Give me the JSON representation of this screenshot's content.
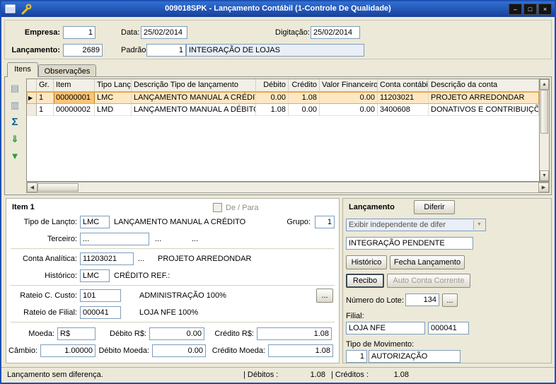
{
  "window": {
    "title": "009018SPK - Lançamento Contábil (1-Controle De Qualidade)"
  },
  "icons": {
    "minimize": "–",
    "maximize": "□",
    "close": "×",
    "new_item": "▤",
    "copy_item": "▥",
    "sum": "Σ",
    "export": "⇓",
    "filter": "▼",
    "row_arrow": "▶",
    "dropdown_arrow": "▼",
    "scroll_up": "▲",
    "scroll_down": "▼",
    "scroll_left": "◀",
    "scroll_right": "▶"
  },
  "header": {
    "empresa_label": "Empresa:",
    "empresa_value": "1",
    "data_label": "Data:",
    "data_value": "25/02/2014",
    "digitacao_label": "Digitação:",
    "digitacao_value": "25/02/2014",
    "lancamento_label": "Lançamento:",
    "lancamento_value": "2689",
    "padrao_label": "Padrão:",
    "padrao_code": "1",
    "padrao_desc": "INTEGRAÇÃO DE LOJAS"
  },
  "tabs": {
    "itens": "Itens",
    "observacoes": "Observações"
  },
  "grid": {
    "columns": [
      "Gr.",
      "Item",
      "Tipo Lanç.",
      "Descrição Tipo de lançamento",
      "Débito",
      "Crédito",
      "Valor Financeiro",
      "Conta contábil",
      "Descrição da conta"
    ],
    "rows": [
      {
        "gr": "1",
        "item": "00000001",
        "tipo": "LMC",
        "desc": "LANÇAMENTO MANUAL A CRÉDITO",
        "debito": "0.00",
        "credito": "1.08",
        "valor_fin": "0.00",
        "conta": "11203021",
        "conta_desc": "PROJETO ARREDONDAR"
      },
      {
        "gr": "1",
        "item": "00000002",
        "tipo": "LMD",
        "desc": "LANÇAMENTO MANUAL A DÉBITO",
        "debito": "1.08",
        "credito": "0.00",
        "valor_fin": "0.00",
        "conta": "3400608",
        "conta_desc": "DONATIVOS E CONTRIBUIÇÕES"
      }
    ]
  },
  "item_panel": {
    "title": "Item 1",
    "de_para_label": "De / Para",
    "tipo_lancto_label": "Tipo de Lançto:",
    "tipo_lancto_value": "LMC",
    "tipo_lancto_desc": "LANÇAMENTO MANUAL A CRÉDITO",
    "grupo_label": "Grupo:",
    "grupo_value": "1",
    "terceiro_label": "Terceiro:",
    "terceiro_value": "...",
    "terceiro_dots": "...",
    "terceiro_desc": "...",
    "conta_analitica_label": "Conta Analítica:",
    "conta_analitica_value": "11203021",
    "conta_analitica_dots": "...",
    "conta_analitica_desc": "PROJETO ARREDONDAR",
    "historico_label": "Histórico:",
    "historico_value": "LMC",
    "historico_desc": "CRÉDITO REF.:",
    "rateio_cc_label": "Rateio C. Custo:",
    "rateio_cc_value": "101",
    "rateio_cc_desc": "ADMINISTRAÇÃO 100%",
    "rateio_cc_button": "...",
    "rateio_filial_label": "Rateio de Filial:",
    "rateio_filial_value": "000041",
    "rateio_filial_desc": "LOJA NFE 100%",
    "moeda_label": "Moeda:",
    "moeda_value": "R$",
    "debito_rs_label": "Débito R$:",
    "debito_rs_value": "0.00",
    "credito_rs_label": "Crédito R$:",
    "credito_rs_value": "1.08",
    "cambio_label": "Câmbio:",
    "cambio_value": "1.00000",
    "debito_moeda_label": "Débito Moeda:",
    "debito_moeda_value": "0.00",
    "credito_moeda_label": "Crédito Moeda:",
    "credito_moeda_value": "1.08"
  },
  "lancamento_panel": {
    "title": "Lançamento",
    "diferir_button": "Diferir",
    "exibir_dropdown": "Exibir independente de difer",
    "status_field": "INTEGRAÇÃO PENDENTE",
    "historico_button": "Histórico",
    "fecha_button": "Fecha Lançamento",
    "recibo_button": "Recibo",
    "auto_cc_button": "Auto Conta Corrente",
    "lote_label": "Número do Lote:",
    "lote_value": "134",
    "lote_button": "...",
    "filial_label": "Filial:",
    "filial_name": "LOJA NFE",
    "filial_code": "000041",
    "tipo_mov_label": "Tipo de Movimento:",
    "tipo_mov_code": "1",
    "tipo_mov_desc": "AUTORIZAÇÃO"
  },
  "status_bar": {
    "message": "Lançamento sem diferença.",
    "debitos_label": "| Débitos :",
    "debitos_value": "1.08",
    "creditos_label": "| Créditos :",
    "creditos_value": "1.08"
  }
}
